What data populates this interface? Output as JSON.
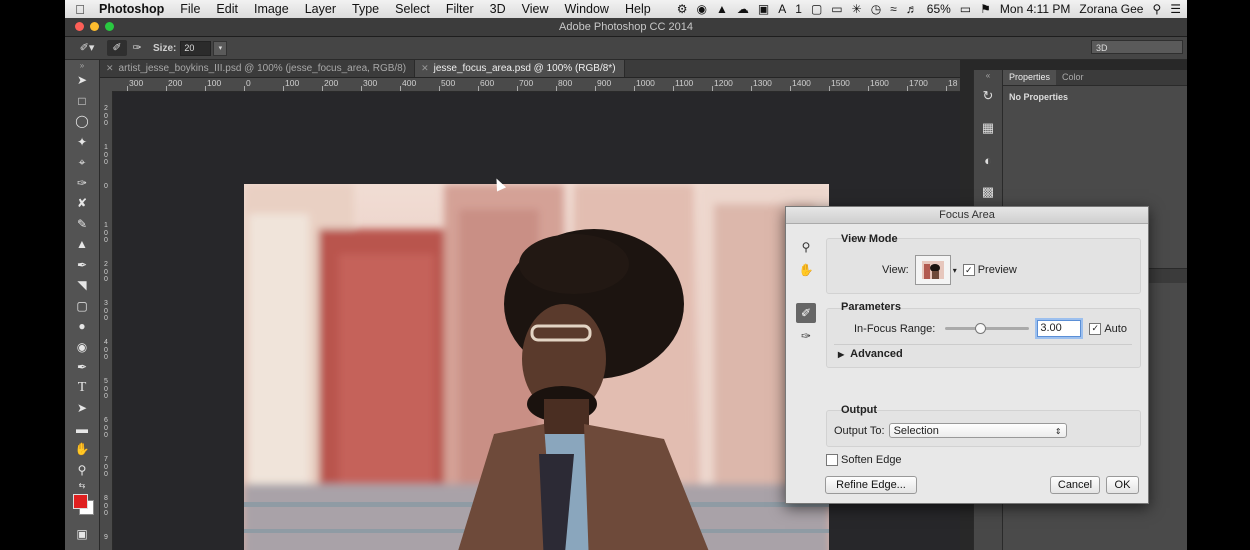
{
  "menubar": {
    "app_name": "Photoshop",
    "items": [
      "File",
      "Edit",
      "Image",
      "Layer",
      "Type",
      "Select",
      "Filter",
      "3D",
      "View",
      "Window",
      "Help"
    ],
    "battery": "65%",
    "clock": "Mon 4:11 PM",
    "user": "Zorana Gee",
    "status_count": "1"
  },
  "window": {
    "title": "Adobe Photoshop CC 2014"
  },
  "options": {
    "size_label": "Size:",
    "size_value": "20",
    "workspace": "3D"
  },
  "tabs": [
    {
      "label": "artist_jesse_boykins_III.psd @ 100% (jesse_focus_area, RGB/8)"
    },
    {
      "label": "jesse_focus_area.psd @ 100% (RGB/8*)"
    }
  ],
  "ruler": {
    "h_labels": [
      "300",
      "200",
      "100",
      "0",
      "100",
      "200",
      "300",
      "400",
      "500",
      "600",
      "700",
      "800",
      "900",
      "1000",
      "1100",
      "1200",
      "1300",
      "1400",
      "1500",
      "1600",
      "1700",
      "18"
    ],
    "v_labels": [
      "2 0 0",
      "1 0 0",
      "0",
      "1 0 0",
      "2 0 0",
      "3 0 0",
      "4 0 0",
      "5 0 0",
      "6 0 0",
      "7 0 0",
      "8 0 0",
      "9"
    ]
  },
  "panels": {
    "tabs": [
      "Properties",
      "Color"
    ],
    "body": "No Properties"
  },
  "dialog": {
    "title": "Focus Area",
    "view_mode_label": "View Mode",
    "view_label": "View:",
    "preview_label": "Preview",
    "parameters_label": "Parameters",
    "in_focus_label": "In-Focus Range:",
    "in_focus_value": "3.00",
    "auto_label": "Auto",
    "advanced_label": "Advanced",
    "output_label": "Output",
    "output_to_label": "Output To:",
    "output_to_value": "Selection",
    "soften_edge_label": "Soften Edge",
    "refine_edge_label": "Refine Edge...",
    "cancel_label": "Cancel",
    "ok_label": "OK"
  }
}
